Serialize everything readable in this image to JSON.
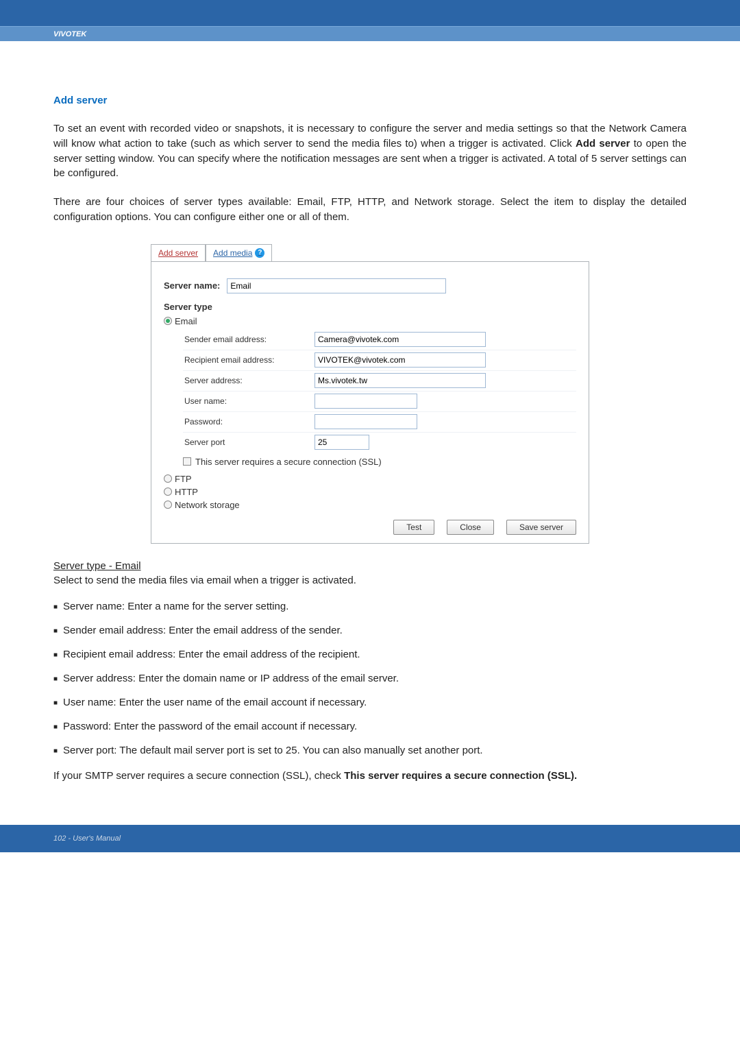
{
  "brand": "VIVOTEK",
  "section_title": "Add server",
  "intro_p1": "To set an event with recorded video or snapshots, it is necessary to configure the server and media settings so that the Network Camera will know what action to take (such as which server to send the media files to) when a trigger is activated. Click ",
  "intro_bold": "Add server",
  "intro_p1b": " to open the server setting window. You can specify where the notification messages are sent when a trigger is activated. A total of 5 server settings can be configured.",
  "intro_p2": "There are four choices of server types available: Email, FTP, HTTP, and Network storage. Select the item to display the detailed configuration options. You can configure either one or all of them.",
  "dialog": {
    "tabs": {
      "add_server": "Add server",
      "add_media": "Add media"
    },
    "server_name_label": "Server name:",
    "server_name_value": "Email",
    "server_type_label": "Server type",
    "radios": {
      "email": "Email",
      "ftp": "FTP",
      "http": "HTTP",
      "network_storage": "Network storage"
    },
    "fields": {
      "sender_label": "Sender email address:",
      "sender_value": "Camera@vivotek.com",
      "recipient_label": "Recipient email address:",
      "recipient_value": "VIVOTEK@vivotek.com",
      "server_addr_label": "Server address:",
      "server_addr_value": "Ms.vivotek.tw",
      "user_label": "User name:",
      "user_value": "",
      "password_label": "Password:",
      "password_value": "",
      "port_label": "Server port",
      "port_value": "25"
    },
    "ssl_label": "This server requires a secure connection (SSL)",
    "buttons": {
      "test": "Test",
      "close": "Close",
      "save": "Save server"
    }
  },
  "server_type_heading": "Server type - Email",
  "server_type_text": "Select to send the media files via email when a trigger is activated.",
  "bullets": [
    "Server name: Enter a name for the server setting.",
    "Sender email address: Enter the email address of the sender.",
    "Recipient email address: Enter the email address of the recipient.",
    "Server address: Enter the domain name or IP address of the email server.",
    "User name: Enter the user name of the email account if necessary.",
    "Password: Enter the password of the email account if necessary.",
    "Server port: The default mail server port is set to 25. You can also manually set another port."
  ],
  "ssl_sentence_a": "If your SMTP server requires a secure connection (SSL), check ",
  "ssl_sentence_b": "This server requires a secure connection (SSL).",
  "footer": "102 - User's Manual"
}
